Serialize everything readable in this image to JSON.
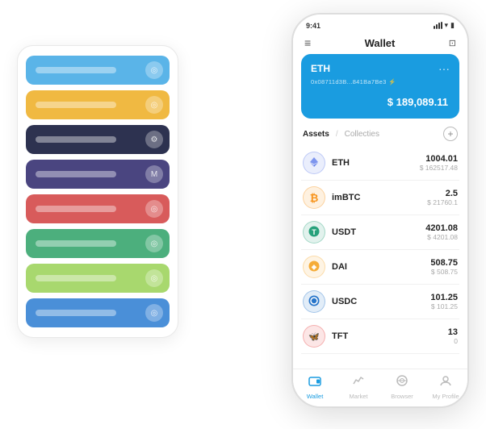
{
  "scene": {
    "card_stack": {
      "bars": [
        {
          "color": "#5ab4e8",
          "text_color": "rgba(255,255,255,0.4)",
          "icon": "◎"
        },
        {
          "color": "#f0b942",
          "text_color": "rgba(255,255,255,0.4)",
          "icon": "◎"
        },
        {
          "color": "#2d3250",
          "text_color": "rgba(255,255,255,0.4)",
          "icon": "⚙"
        },
        {
          "color": "#4a4580",
          "text_color": "rgba(255,255,255,0.4)",
          "icon": "M"
        },
        {
          "color": "#d85b5b",
          "text_color": "rgba(255,255,255,0.4)",
          "icon": "◎"
        },
        {
          "color": "#4caf7d",
          "text_color": "rgba(255,255,255,0.4)",
          "icon": "◎"
        },
        {
          "color": "#a8d86e",
          "text_color": "rgba(255,255,255,0.4)",
          "icon": "◎"
        },
        {
          "color": "#4a8fd8",
          "text_color": "rgba(255,255,255,0.4)",
          "icon": "◎"
        }
      ]
    },
    "phone": {
      "status_time": "9:41",
      "header_title": "Wallet",
      "eth_card": {
        "name": "ETH",
        "address": "0x08711d3B...841Ba7Be3 ⚡",
        "balance": "$ 189,089.11",
        "currency_symbol": "$"
      },
      "assets_section": {
        "tab_active": "Assets",
        "tab_divider": "/",
        "tab_inactive": "Collecties"
      },
      "assets": [
        {
          "name": "ETH",
          "icon_color": "#627eea",
          "icon_symbol": "◆",
          "amount": "1004.01",
          "usd": "$ 162517.48"
        },
        {
          "name": "imBTC",
          "icon_color": "#f7931a",
          "icon_symbol": "₿",
          "amount": "2.5",
          "usd": "$ 21760.1"
        },
        {
          "name": "USDT",
          "icon_color": "#26a17b",
          "icon_symbol": "T",
          "amount": "4201.08",
          "usd": "$ 4201.08"
        },
        {
          "name": "DAI",
          "icon_color": "#f5ac37",
          "icon_symbol": "◈",
          "amount": "508.75",
          "usd": "$ 508.75"
        },
        {
          "name": "USDC",
          "icon_color": "#2775ca",
          "icon_symbol": "⊙",
          "amount": "101.25",
          "usd": "$ 101.25"
        },
        {
          "name": "TFT",
          "icon_color": "#e84142",
          "icon_symbol": "🦋",
          "amount": "13",
          "usd": "0"
        }
      ],
      "nav": [
        {
          "label": "Wallet",
          "icon": "◎",
          "active": true
        },
        {
          "label": "Market",
          "icon": "📈",
          "active": false
        },
        {
          "label": "Browser",
          "icon": "🌐",
          "active": false
        },
        {
          "label": "My Profile",
          "icon": "👤",
          "active": false
        }
      ]
    }
  }
}
